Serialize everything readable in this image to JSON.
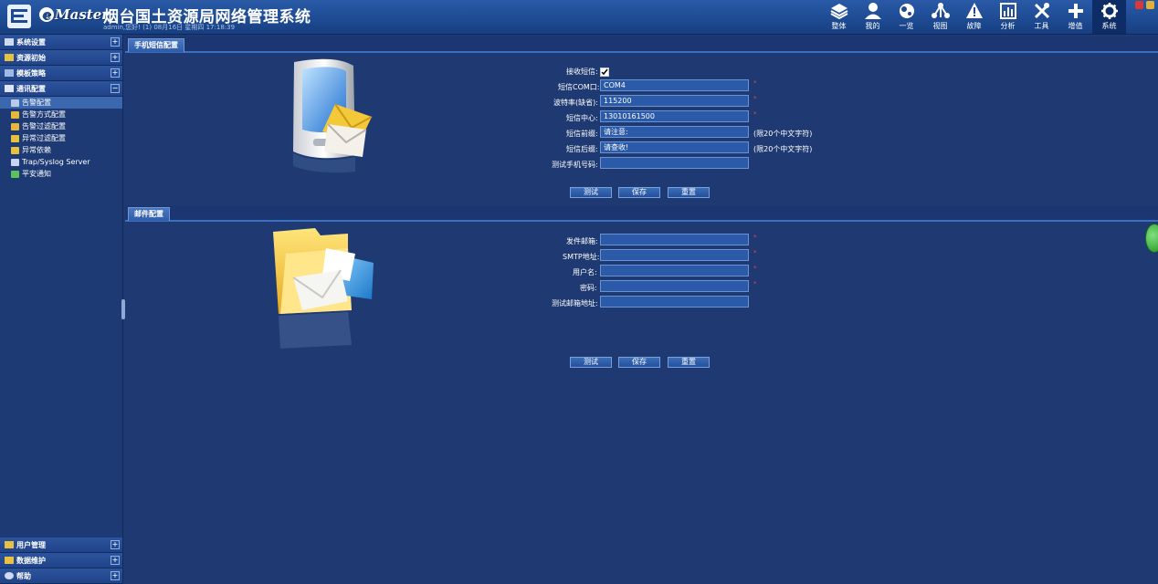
{
  "header": {
    "brand": "Master",
    "title": "烟台国土资源局网络管理系统",
    "subtitle": "admin,您好! (1) 08月16日 星期四 17:18:39",
    "nav": [
      {
        "label": "整体",
        "icon": "layers-icon"
      },
      {
        "label": "我的",
        "icon": "user-icon"
      },
      {
        "label": "一览",
        "icon": "globe-icon"
      },
      {
        "label": "视图",
        "icon": "topology-icon"
      },
      {
        "label": "故障",
        "icon": "warning-icon"
      },
      {
        "label": "分析",
        "icon": "chart-icon"
      },
      {
        "label": "工具",
        "icon": "tools-icon"
      },
      {
        "label": "增值",
        "icon": "plus-icon"
      },
      {
        "label": "系统",
        "icon": "gear-icon",
        "active": true
      }
    ]
  },
  "sidebar": {
    "sections": [
      {
        "label": "系统设置",
        "toggle": "+"
      },
      {
        "label": "资源初始",
        "toggle": "+"
      },
      {
        "label": "模板策略",
        "toggle": "+"
      },
      {
        "label": "通讯配置",
        "toggle": "−"
      }
    ],
    "items": [
      {
        "label": "告警配置",
        "active": true
      },
      {
        "label": "告警方式配置"
      },
      {
        "label": "告警过滤配置"
      },
      {
        "label": "异常过滤配置"
      },
      {
        "label": "异常依赖"
      },
      {
        "label": "Trap/Syslog Server"
      },
      {
        "label": "平安通知"
      }
    ],
    "bottom_sections": [
      {
        "label": "用户管理",
        "toggle": "+"
      },
      {
        "label": "数据维护",
        "toggle": "+"
      },
      {
        "label": "帮助",
        "toggle": "+"
      }
    ]
  },
  "sms": {
    "tab": "手机短信配置",
    "receive_label": "接收短信:",
    "receive_checked": true,
    "fields": [
      {
        "label": "短信COM口:",
        "value": "COM4",
        "required": true
      },
      {
        "label": "波特率(缺省):",
        "value": "115200",
        "required": true
      },
      {
        "label": "短信中心:",
        "value": "13010161500",
        "required": true
      },
      {
        "label": "短信前缀:",
        "value": "请注意:",
        "hint": "(限20个中文字符)"
      },
      {
        "label": "短信后缀:",
        "value": "请查收!",
        "hint": "(限20个中文字符)"
      },
      {
        "label": "测试手机号码:",
        "value": ""
      }
    ],
    "buttons": [
      "测试",
      "保存",
      "重置"
    ]
  },
  "mail": {
    "tab": "邮件配置",
    "fields": [
      {
        "label": "发件邮箱:",
        "value": "",
        "required": true
      },
      {
        "label": "SMTP地址:",
        "value": "",
        "required": true
      },
      {
        "label": "用户名:",
        "value": "",
        "required": true
      },
      {
        "label": "密码:",
        "value": "",
        "required": true
      },
      {
        "label": "测试邮箱地址:",
        "value": ""
      }
    ],
    "buttons": [
      "测试",
      "保存",
      "重置"
    ]
  }
}
